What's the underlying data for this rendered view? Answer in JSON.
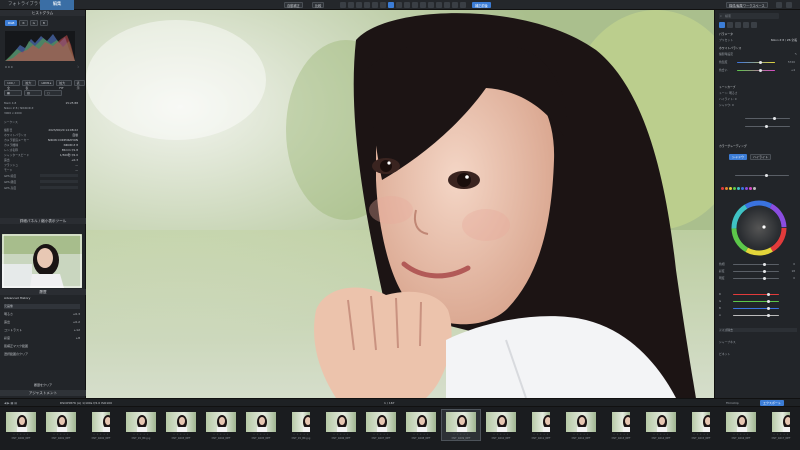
{
  "topbar": {
    "tabs": [
      "フォトライブラリ",
      "編集"
    ],
    "center_buttons": [
      "自動補正",
      "比較"
    ],
    "right_button": "補正前後",
    "far_right_button": "構成/編集ワークスペース"
  },
  "left_panel": {
    "histogram_title": "ヒストグラム",
    "histogram_mode": "RGB",
    "histogram_readout": "0 0 0",
    "mode_buttons": [
      "100 / 全",
      "拡大表",
      "LRM1s",
      "拡大FIT",
      "表示"
    ],
    "exposure_label": "Mark 4.8",
    "exposure_value": "15:25 88",
    "camera_label": "Nikon Z 8 / NIKKOR Z",
    "image_size": "3000 x 2000",
    "metadata_title": "シーケンス",
    "metadata": [
      {
        "k": "撮影日",
        "v": "2023/06/20 14:08:22"
      },
      {
        "k": "ホワイトバランス",
        "v": "自動"
      },
      {
        "k": "カメラ製造メーカー",
        "v": "NIKON CORPORATION"
      },
      {
        "k": "カメラ機種",
        "v": "NIKON Z 8"
      },
      {
        "k": "レンズ名称",
        "v": "85mm f/1.8"
      },
      {
        "k": "シャッタースピード",
        "v": "1/500秒 f/2.0"
      },
      {
        "k": "露出",
        "v": "+0.3"
      },
      {
        "k": "フラッシュ",
        "v": "—"
      },
      {
        "k": "モード",
        "v": "—"
      }
    ],
    "gps_labels": [
      "GPS 緯度",
      "GPS 経度",
      "GPS 高度"
    ],
    "navigator_title": "詳細パネル / 縮小表示ツール",
    "navigator_caption": "履歴",
    "history_title": "Advanced History",
    "history_items": [
      {
        "label": "元画像",
        "value": ""
      },
      {
        "label": "明るさ",
        "value": "+0.3"
      },
      {
        "label": "露出",
        "value": "+0.2"
      },
      {
        "label": "コントラスト",
        "value": "+12"
      },
      {
        "label": "彩度",
        "value": "+8"
      },
      {
        "label": "肌補正マスク範囲",
        "value": ""
      },
      {
        "label": "選択範囲のクリア",
        "value": ""
      }
    ],
    "footer_button": "履歴をクリア",
    "bottom_tab": "アジャストメント"
  },
  "right_panel": {
    "search_placeholder": "検索",
    "section_title": "パラメータ",
    "preset_label": "プリセット",
    "preset_value": "Nikon Z 8 / Z6 全般",
    "wb_label": "ホワイトバランス",
    "wb_mode": "撮影時設定",
    "wb_sliders": [
      {
        "label": "色温度",
        "value": "5720"
      },
      {
        "label": "色合い",
        "value": "+4"
      }
    ],
    "tone_title": "トーンカーブ",
    "tone_rows": [
      "トーン: 明るさ",
      "ハイライト: 0",
      "シャドウ: 0"
    ],
    "color_title": "カラーグレーディング",
    "color_tabs": [
      "シャドウ",
      "ハイライト"
    ],
    "swatch_colors": [
      "#e23b3b",
      "#e68a2e",
      "#e3d53a",
      "#5cc74a",
      "#3fc2c4",
      "#3a73e0",
      "#8a4de0",
      "#d94bc5",
      "#bbbbbb"
    ],
    "mix_rows": [
      {
        "label": "色相",
        "value": "0"
      },
      {
        "label": "彩度",
        "value": "18"
      },
      {
        "label": "明度",
        "value": "0"
      }
    ],
    "rgb_rows": [
      "R",
      "G",
      "B",
      "A"
    ],
    "lower_rows": [
      "ノイズ除去",
      "シャープネス",
      "ビネット"
    ]
  },
  "filmstrip": {
    "header": "DSC05876 (A) 1/100s f/2.0 ISO100",
    "counter": "1 / 167",
    "right_label": "Filmstrip",
    "export_button": "エクスポート",
    "thumbs": [
      "DST_4600_NEF",
      "DST_4601_NEF",
      "DST_4602_NEF",
      "DST_45_BK.jpg",
      "DST_4603_NEF",
      "DST_4604_NEF",
      "DST_4605_NEF",
      "DST_45_BK.jpg",
      "DST_4606_NEF",
      "DST_4607_NEF",
      "DST_4608_NEF",
      "DST_4609_NEF",
      "DST_4610_NEF",
      "DST_4611_NEF",
      "DST_4612_NEF",
      "DST_4613_NEF",
      "DST_4614_NEF",
      "DST_4615_NEF",
      "DST_4616_NEF",
      "DST_4617_NEF"
    ],
    "selected_index": 11
  }
}
